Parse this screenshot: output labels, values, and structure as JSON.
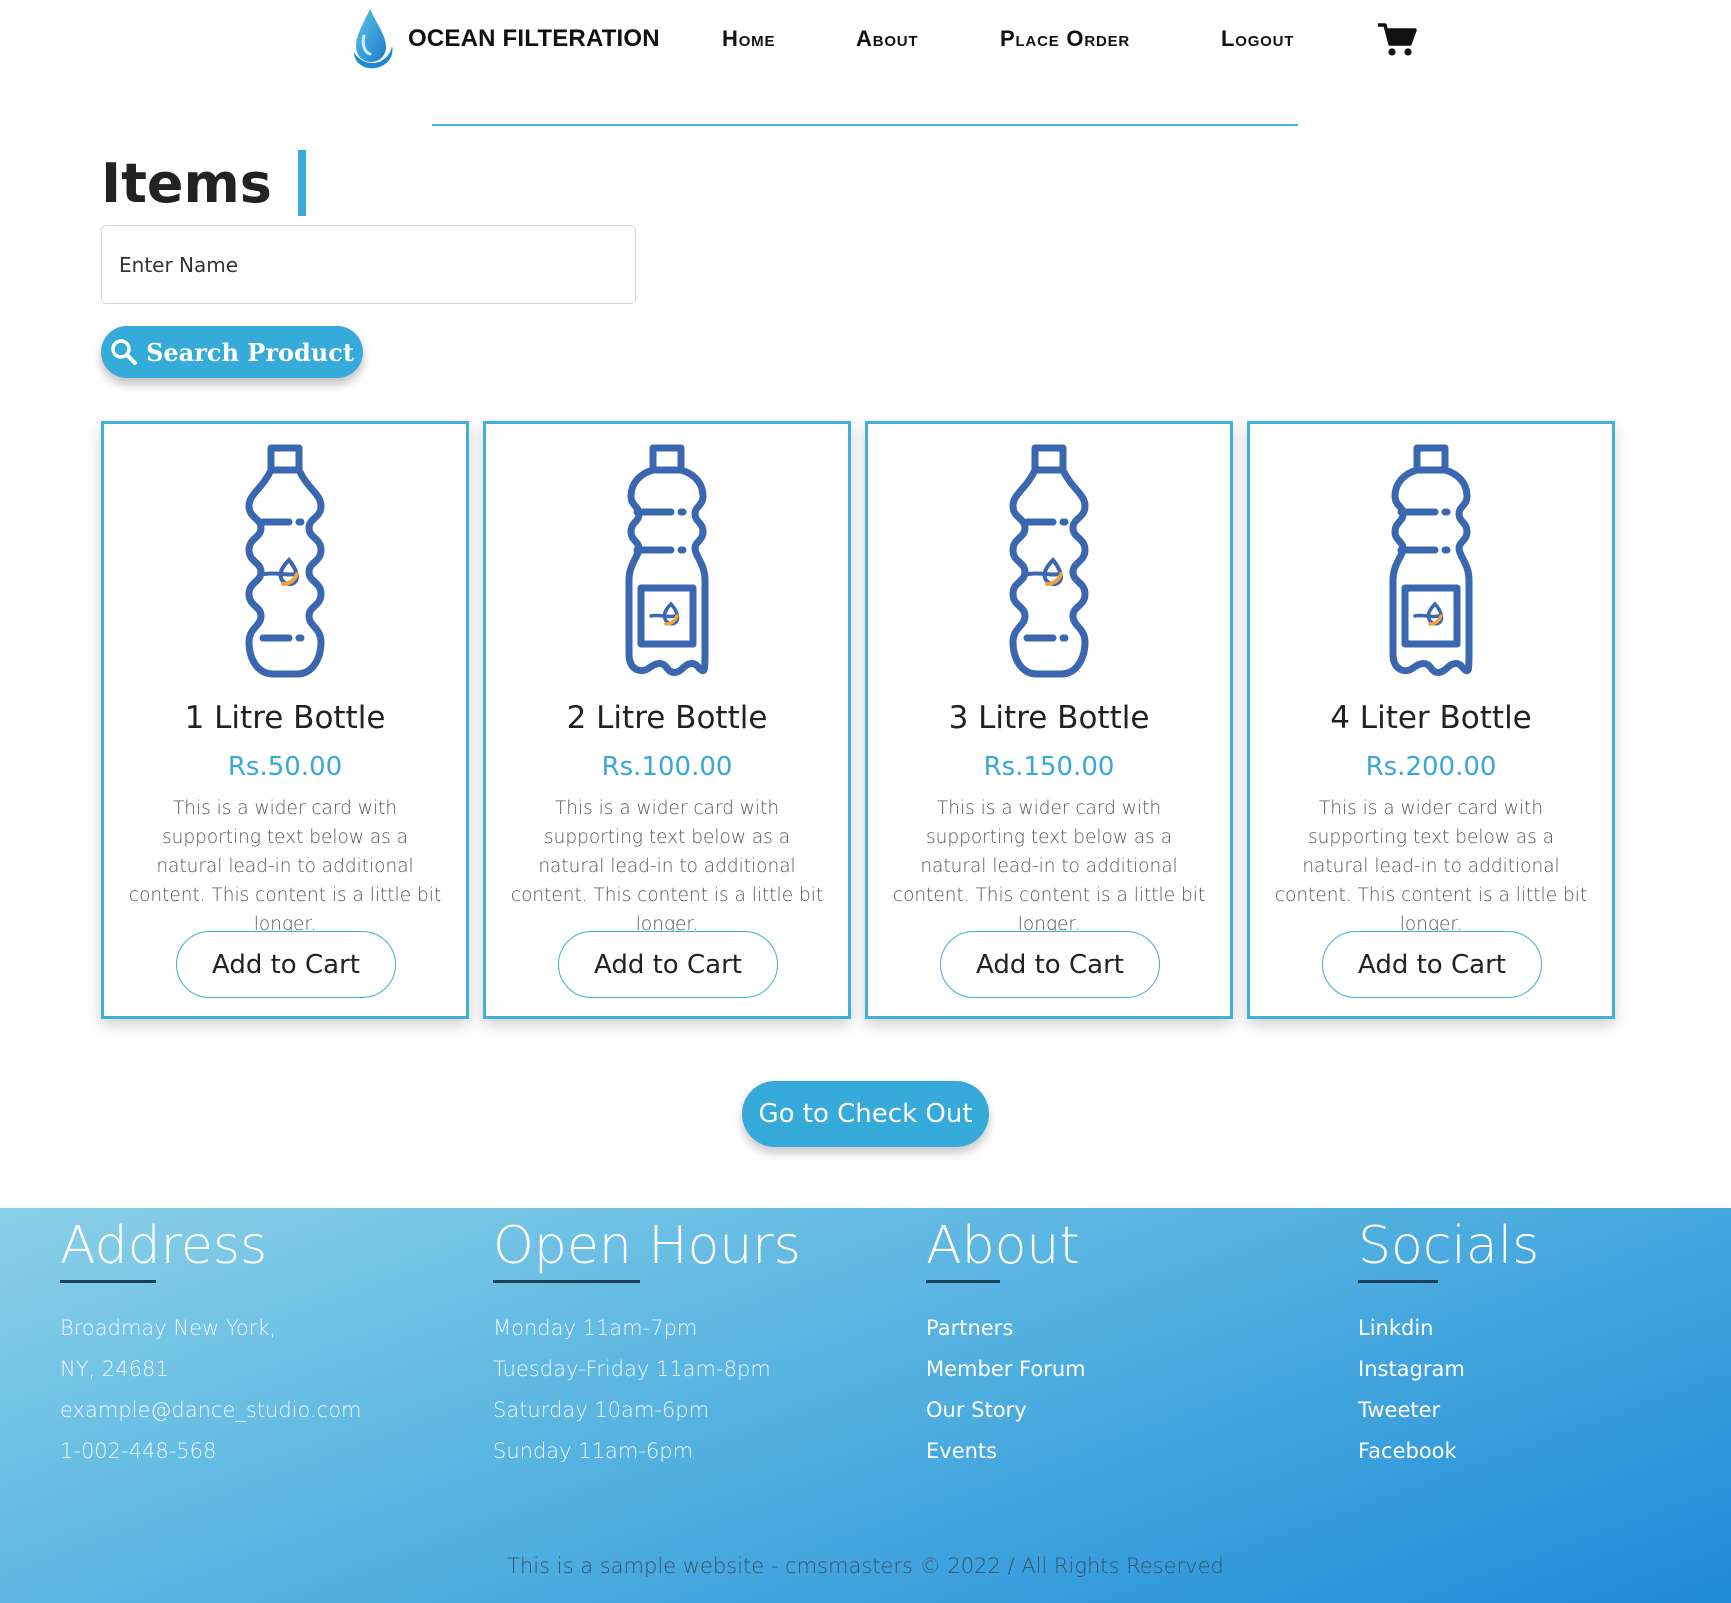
{
  "nav": {
    "brand": "OCEAN FILTERATION",
    "links": [
      "Home",
      "About",
      "Place Order",
      "Logout"
    ],
    "cart_icon": "cart-icon"
  },
  "items": {
    "title": "Items",
    "search_placeholder": "Enter Name",
    "search_button": "Search Product"
  },
  "products": [
    {
      "name": "1 Litre Bottle",
      "price": "Rs.50.00",
      "description": "This is a wider card with supporting text below as a natural lead-in to additional content. This content is a little bit longer.",
      "button": "Add to Cart",
      "icon": "bottle-icon"
    },
    {
      "name": "2 Litre Bottle",
      "price": "Rs.100.00",
      "description": "This is a wider card with supporting text below as a natural lead-in to additional content. This content is a little bit longer.",
      "button": "Add to Cart",
      "icon": "bottle-label-icon"
    },
    {
      "name": "3 Litre Bottle",
      "price": "Rs.150.00",
      "description": "This is a wider card with supporting text below as a natural lead-in to additional content. This content is a little bit longer.",
      "button": "Add to Cart",
      "icon": "bottle-icon"
    },
    {
      "name": "4 Liter Bottle",
      "price": "Rs.200.00",
      "description": "This is a wider card with supporting text below as a natural lead-in to additional content. This content is a little bit longer.",
      "button": "Add to Cart",
      "icon": "bottle-label-icon"
    }
  ],
  "checkout_button": "Go to Check Out",
  "footer": {
    "address": {
      "title": "Address",
      "lines": [
        "Broadmay New York,",
        "NY, 24681",
        "example@dance_studio.com",
        "1-002-448-568"
      ]
    },
    "hours": {
      "title": "Open Hours",
      "lines": [
        "Monday 11am-7pm",
        "Tuesday-Friday 11am-8pm",
        "Saturday 10am-6pm",
        "Sunday 11am-6pm"
      ]
    },
    "about": {
      "title": "About",
      "links": [
        "Partners",
        "Member Forum",
        "Our Story",
        "Events"
      ]
    },
    "socials": {
      "title": "Socials",
      "links": [
        "Linkdin",
        "Instagram",
        "Tweeter",
        "Facebook"
      ]
    },
    "copyright": "This is a sample website - cmsmasters © 2022 / All Rights Reserved"
  },
  "colors": {
    "accent": "#36aad8",
    "card_border": "#3fb0d8",
    "bottle": "#3a67b0"
  }
}
